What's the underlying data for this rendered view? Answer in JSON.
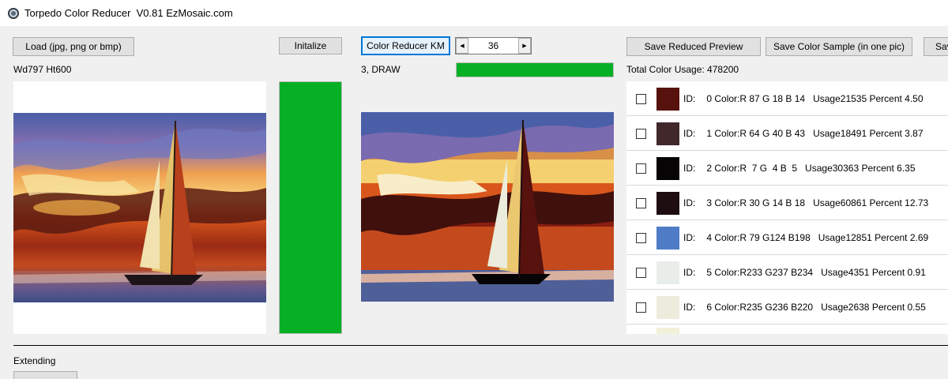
{
  "window": {
    "title": "Torpedo Color Reducer  V0.81 EzMosaic.com",
    "icon": "lens-icon"
  },
  "toolbar": {
    "load_label": "Load (jpg, png or bmp)",
    "initialize_label": "Initalize",
    "color_reducer_label": "Color Reducer KM",
    "colors_count": "36",
    "save_preview_label": "Save Reduced Preview",
    "save_sample_label": "Save Color Sample (in one pic)",
    "save_extra_label": "Sav"
  },
  "status": {
    "dimensions": "Wd797 Ht600",
    "draw_status": "3, DRAW",
    "draw_progress": 1.0,
    "init_progress": 1.0,
    "total_usage": "Total Color Usage: 478200"
  },
  "colors": [
    {
      "id_label": "ID:",
      "info": "0 Color:R 87 G 18 B 14   Usage21535 Percent 4.50",
      "swatch": "#57120e"
    },
    {
      "id_label": "ID:",
      "info": "1 Color:R 64 G 40 B 43   Usage18491 Percent 3.87",
      "swatch": "#40282b"
    },
    {
      "id_label": "ID:",
      "info": "2 Color:R  7 G  4 B  5   Usage30363 Percent 6.35",
      "swatch": "#070405"
    },
    {
      "id_label": "ID:",
      "info": "3 Color:R 30 G 14 B 18   Usage60861 Percent 12.73",
      "swatch": "#1e0e12"
    },
    {
      "id_label": "ID:",
      "info": "4 Color:R 79 G124 B198   Usage12851 Percent 2.69",
      "swatch": "#4f7cc6"
    },
    {
      "id_label": "ID:",
      "info": "5 Color:R233 G237 B234   Usage4351 Percent 0.91",
      "swatch": "#e9edea"
    },
    {
      "id_label": "ID:",
      "info": "6 Color:R235 G236 B220   Usage2638 Percent 0.55",
      "swatch": "#ebecdc"
    },
    {
      "id_label": "",
      "info": "",
      "swatch": "#f1f0d8"
    }
  ],
  "footer": {
    "extending_label": "Extending"
  },
  "accent": {
    "progress_green": "#06b025",
    "focus_blue": "#0078d7"
  }
}
